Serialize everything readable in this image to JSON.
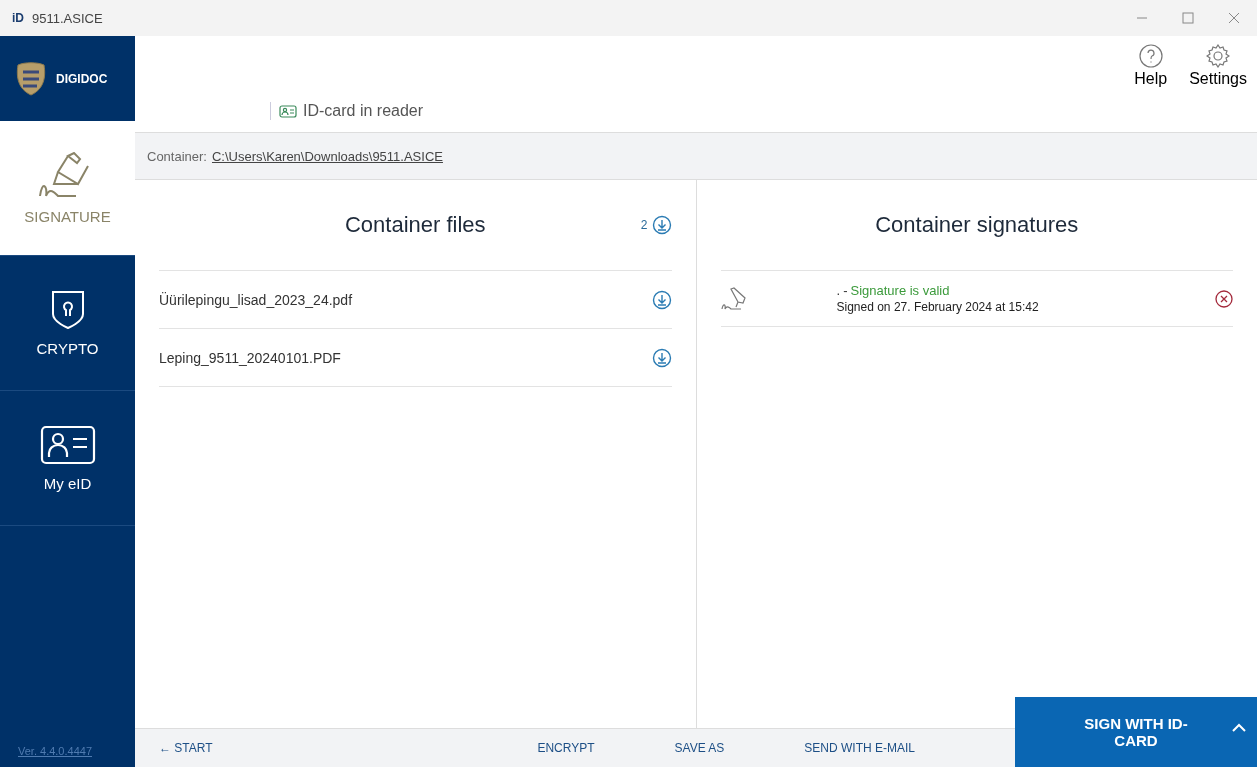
{
  "window": {
    "title": "9511.ASICE",
    "app_badge": "iD"
  },
  "sidebar": {
    "brand": "DIGIDOC",
    "items": [
      {
        "label": "SIGNATURE",
        "kind": "signature",
        "selected": true
      },
      {
        "label": "CRYPTO",
        "kind": "crypto",
        "selected": false
      },
      {
        "label": "My eID",
        "kind": "eid",
        "selected": false
      }
    ],
    "version": "Ver. 4.4.0.4447"
  },
  "header": {
    "card_status": "ID-card in reader",
    "actions": [
      {
        "label": "Help",
        "kind": "help"
      },
      {
        "label": "Settings",
        "kind": "settings"
      }
    ]
  },
  "container_bar": {
    "label": "Container:",
    "path": "C:\\Users\\Karen\\Downloads\\9511.ASICE"
  },
  "files": {
    "title": "Container files",
    "count": "2",
    "items": [
      {
        "name": "Üürilepingu_lisad_2023_24.pdf"
      },
      {
        "name": "Leping_9511_20240101.PDF"
      }
    ]
  },
  "signatures": {
    "title": "Container signatures",
    "items": [
      {
        "signer": ".",
        "separator": "-",
        "status": "Signature is valid",
        "date": "Signed on 27. February 2024 at 15:42"
      }
    ]
  },
  "footer": {
    "back": "← START",
    "actions": [
      "ENCRYPT",
      "SAVE AS",
      "SEND WITH E-MAIL"
    ],
    "sign_button": "SIGN WITH ID-CARD"
  }
}
